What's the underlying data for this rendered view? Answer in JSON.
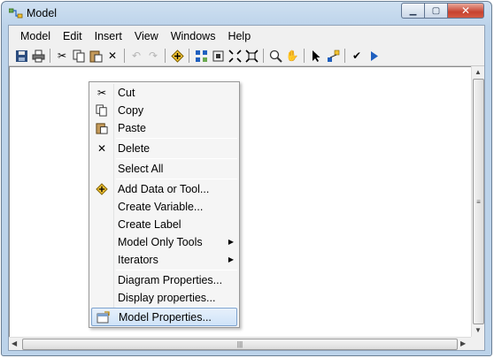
{
  "window": {
    "title": "Model"
  },
  "menubar": {
    "items": [
      "Model",
      "Edit",
      "Insert",
      "View",
      "Windows",
      "Help"
    ]
  },
  "context_menu": {
    "items": [
      {
        "label": "Cut",
        "icon": "cut-icon"
      },
      {
        "label": "Copy",
        "icon": "copy-icon"
      },
      {
        "label": "Paste",
        "icon": "paste-icon"
      },
      {
        "label": "Delete",
        "icon": "delete-icon"
      },
      {
        "label": "Select All",
        "icon": ""
      },
      {
        "label": "Add Data or Tool...",
        "icon": "add-data-icon"
      },
      {
        "label": "Create Variable...",
        "icon": ""
      },
      {
        "label": "Create Label",
        "icon": ""
      },
      {
        "label": "Model Only Tools",
        "icon": "",
        "submenu": true
      },
      {
        "label": "Iterators",
        "icon": "",
        "submenu": true
      },
      {
        "label": "Diagram Properties...",
        "icon": ""
      },
      {
        "label": "Display properties...",
        "icon": ""
      },
      {
        "label": "Model Properties...",
        "icon": "model-properties-icon",
        "highlighted": true
      }
    ]
  },
  "colors": {
    "highlight_border": "#7da2ce",
    "close_button": "#c7422f",
    "run_arrow": "#1f5fbf"
  }
}
